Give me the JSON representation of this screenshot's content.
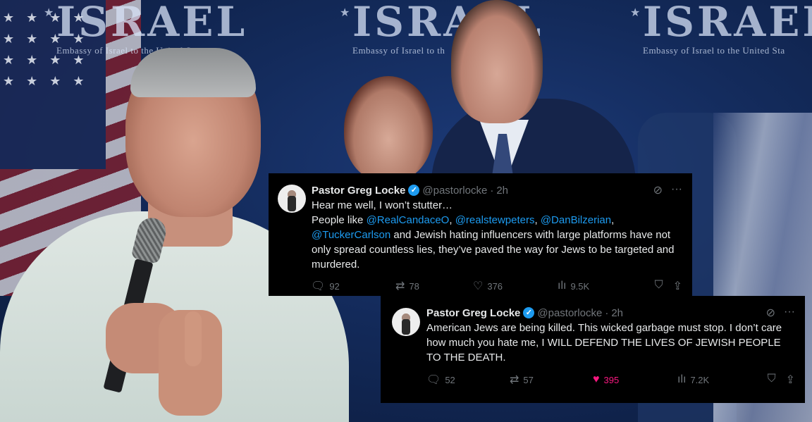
{
  "background": {
    "banners": [
      {
        "word": "ISRAEL",
        "sub": "Embassy of Israel to the United States"
      },
      {
        "word": "ISRAEL",
        "sub": "Embassy of Israel to th"
      },
      {
        "word": "ISRAEL",
        "sub": "Embassy of Israel to the United Sta"
      }
    ]
  },
  "tweets": [
    {
      "name": "Pastor Greg Locke",
      "handle": "@pastorlocke",
      "time": "2h",
      "line1": "Hear me well, I won’t stutter…",
      "line2_prefix": "People like ",
      "m1": "@RealCandaceO",
      "sep1": ", ",
      "m2": "@realstewpeters",
      "sep2": ", ",
      "m3": "@DanBilzerian",
      "sep3": ",",
      "m4": "@TuckerCarlson",
      "rest": " and Jewish hating influencers with large platforms have not only spread countless lies, they’ve paved the way for Jews to be targeted and murdered.",
      "replies": "92",
      "reposts": "78",
      "likes": "376",
      "views": "9.5K"
    },
    {
      "name": "Pastor Greg Locke",
      "handle": "@pastorlocke",
      "time": "2h",
      "text": "American Jews are being killed. This wicked garbage must stop. I don’t care how much you hate me, I WILL DEFEND THE LIVES OF JEWISH PEOPLE TO THE DEATH.",
      "replies": "52",
      "reposts": "57",
      "likes": "395",
      "views": "7.2K"
    }
  ],
  "icons": {
    "verified": "verified-badge-icon",
    "grok": "grok-icon",
    "more": "more-icon",
    "reply": "reply-icon",
    "repost": "repost-icon",
    "like": "heart-icon",
    "views": "views-icon",
    "bookmark": "bookmark-icon",
    "share": "share-icon"
  },
  "colors": {
    "link": "#1d9bf0",
    "liked": "#f91880",
    "muted": "#71767b",
    "tweet_bg": "#000000"
  }
}
